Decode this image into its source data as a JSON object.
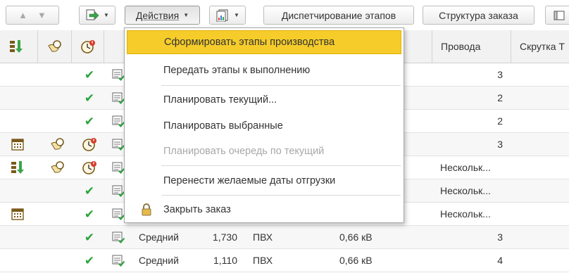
{
  "toolbar": {
    "actions_label": "Действия",
    "dispatch_label": "Диспетчирование этапов",
    "structure_label": "Структура заказа"
  },
  "header": {
    "columns": [
      "Провода",
      "Скрутка Т"
    ]
  },
  "menu": {
    "items": [
      {
        "label": "Сформировать этапы производства",
        "state": "highlighted"
      },
      {
        "label": "Передать этапы к выполнению",
        "state": "enabled"
      },
      {
        "label": "Планировать текущий...",
        "state": "enabled"
      },
      {
        "label": "Планировать выбранные",
        "state": "enabled"
      },
      {
        "label": "Планировать очередь по текущий",
        "state": "disabled"
      },
      {
        "label": "Перенести желаемые даты отгрузки",
        "state": "enabled"
      },
      {
        "label": "Закрыть заказ",
        "state": "enabled",
        "icon": "lock-icon"
      }
    ]
  },
  "rows": [
    {
      "icons": [
        "",
        "",
        "check"
      ],
      "wires": "3"
    },
    {
      "icons": [
        "",
        "",
        "check"
      ],
      "wires": "2"
    },
    {
      "icons": [
        "",
        "",
        "check"
      ],
      "wires": "2"
    },
    {
      "icons": [
        "calendar",
        "hand-gear",
        "clock-warning"
      ],
      "wires": "3"
    },
    {
      "icons": [
        "stages",
        "hand-gear",
        "clock-warning"
      ],
      "wires": "Нескольк..."
    },
    {
      "icons": [
        "",
        "",
        "check"
      ],
      "wires": "Нескольк..."
    },
    {
      "icons": [
        "calendar",
        "",
        "check"
      ],
      "wires": "Нескольк..."
    },
    {
      "icons": [
        "",
        "",
        "check"
      ],
      "priority": "Средний",
      "qty": "1,730",
      "material": "ПВХ",
      "voltage": "0,66 кВ",
      "wires": "3"
    },
    {
      "icons": [
        "",
        "",
        "check"
      ],
      "priority": "Средний",
      "qty": "1,110",
      "material": "ПВХ",
      "voltage": "0,66 кВ",
      "wires": "4"
    }
  ],
  "colors": {
    "accent": "#f5cc2a",
    "check": "#2aa33c"
  }
}
